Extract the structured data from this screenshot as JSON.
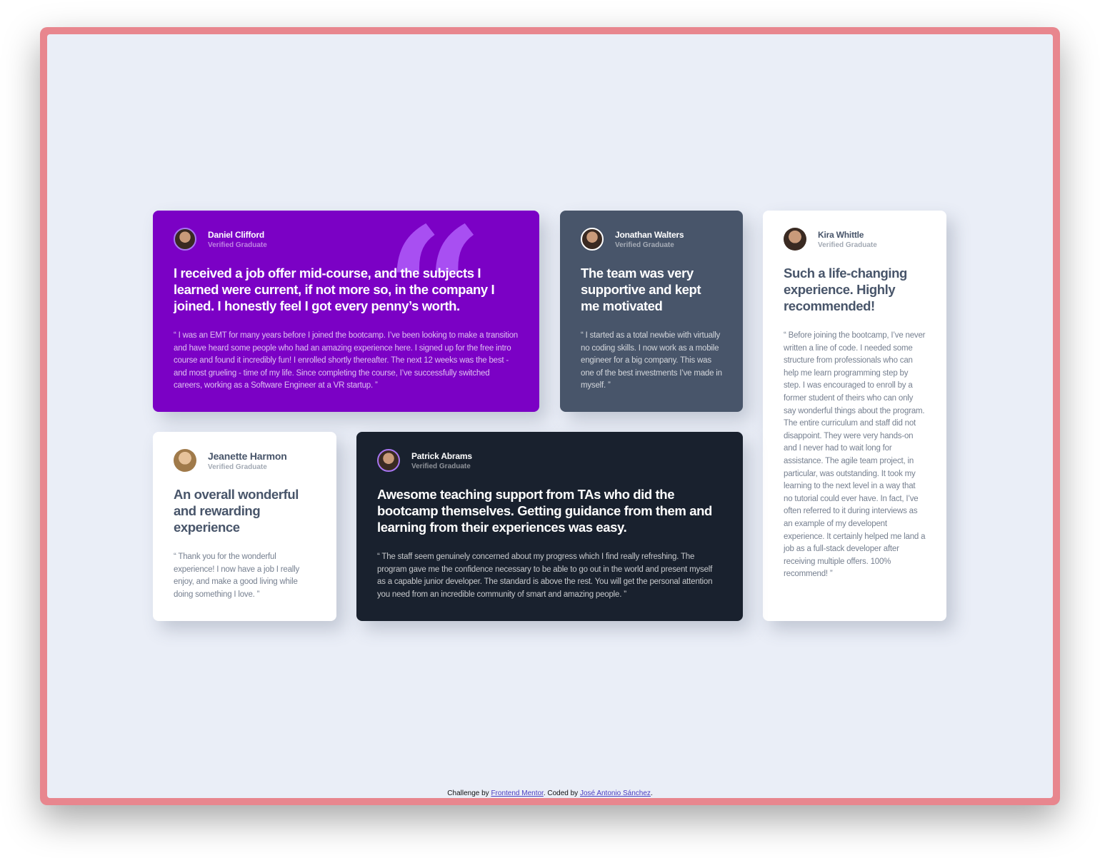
{
  "testimonials": [
    {
      "name": "Daniel Clifford",
      "role": "Verified Graduate",
      "title": "I received a job offer mid-course, and the subjects I learned were current, if not more so, in the company I joined. I honestly feel I got every penny’s worth.",
      "body": "“ I was an EMT for many years before I joined the bootcamp. I’ve been looking to make a transition and have heard some people who had an amazing experience here. I signed up for the free intro course and found it incredibly fun! I enrolled shortly thereafter. The next 12 weeks was the best - and most grueling - time of my life. Since completing the course, I’ve successfully switched careers, working as a Software Engineer at a VR startup. ”"
    },
    {
      "name": "Jonathan Walters",
      "role": "Verified Graduate",
      "title": "The team was very supportive and kept me motivated",
      "body": "“ I started as a total newbie with virtually no coding skills. I now work as a mobile engineer for a big company. This was one of the best investments I’ve made in myself. ”"
    },
    {
      "name": "Kira Whittle",
      "role": "Verified Graduate",
      "title": "Such a life-changing experience. Highly recommended!",
      "body": "“ Before joining the bootcamp, I’ve never written a line of code. I needed some structure from professionals who can help me learn programming step by step. I was encouraged to enroll by a former student of theirs who can only say wonderful things about the program. The entire curriculum and staff did not disappoint. They were very hands-on and I never had to wait long for assistance. The agile team project, in particular, was outstanding. It took my learning to the next level in a way that no tutorial could ever have. In fact, I’ve often referred to it during interviews as an example of my developent experience. It certainly helped me land a job as a full-stack developer after receiving multiple offers. 100% recommend! ”"
    },
    {
      "name": "Jeanette Harmon",
      "role": "Verified Graduate",
      "title": "An overall wonderful and rewarding experience",
      "body": "“ Thank you for the wonderful experience! I now have a job I really enjoy, and make a good living while doing something I love. ”"
    },
    {
      "name": "Patrick Abrams",
      "role": "Verified Graduate",
      "title": "Awesome teaching support from TAs who did the bootcamp themselves. Getting guidance from them and learning from their experiences was easy.",
      "body": "“ The staff seem genuinely concerned about my progress which I find really refreshing. The program gave me the confidence necessary to be able to go out in the world and present myself as a capable junior developer. The standard is above the rest. You will get the personal attention you need from an incredible community of smart and amazing people. ”"
    }
  ],
  "footer": {
    "prefix": "Challenge by ",
    "link1": "Frontend Mentor",
    "middle": ". Coded by ",
    "link2": "José Antonio Sánchez",
    "suffix": "."
  },
  "colors": {
    "purple": "#7b01c5",
    "grayblue": "#48556a",
    "dark": "#19212e",
    "frame": "#e8868e",
    "bg": "#eaeef7"
  }
}
